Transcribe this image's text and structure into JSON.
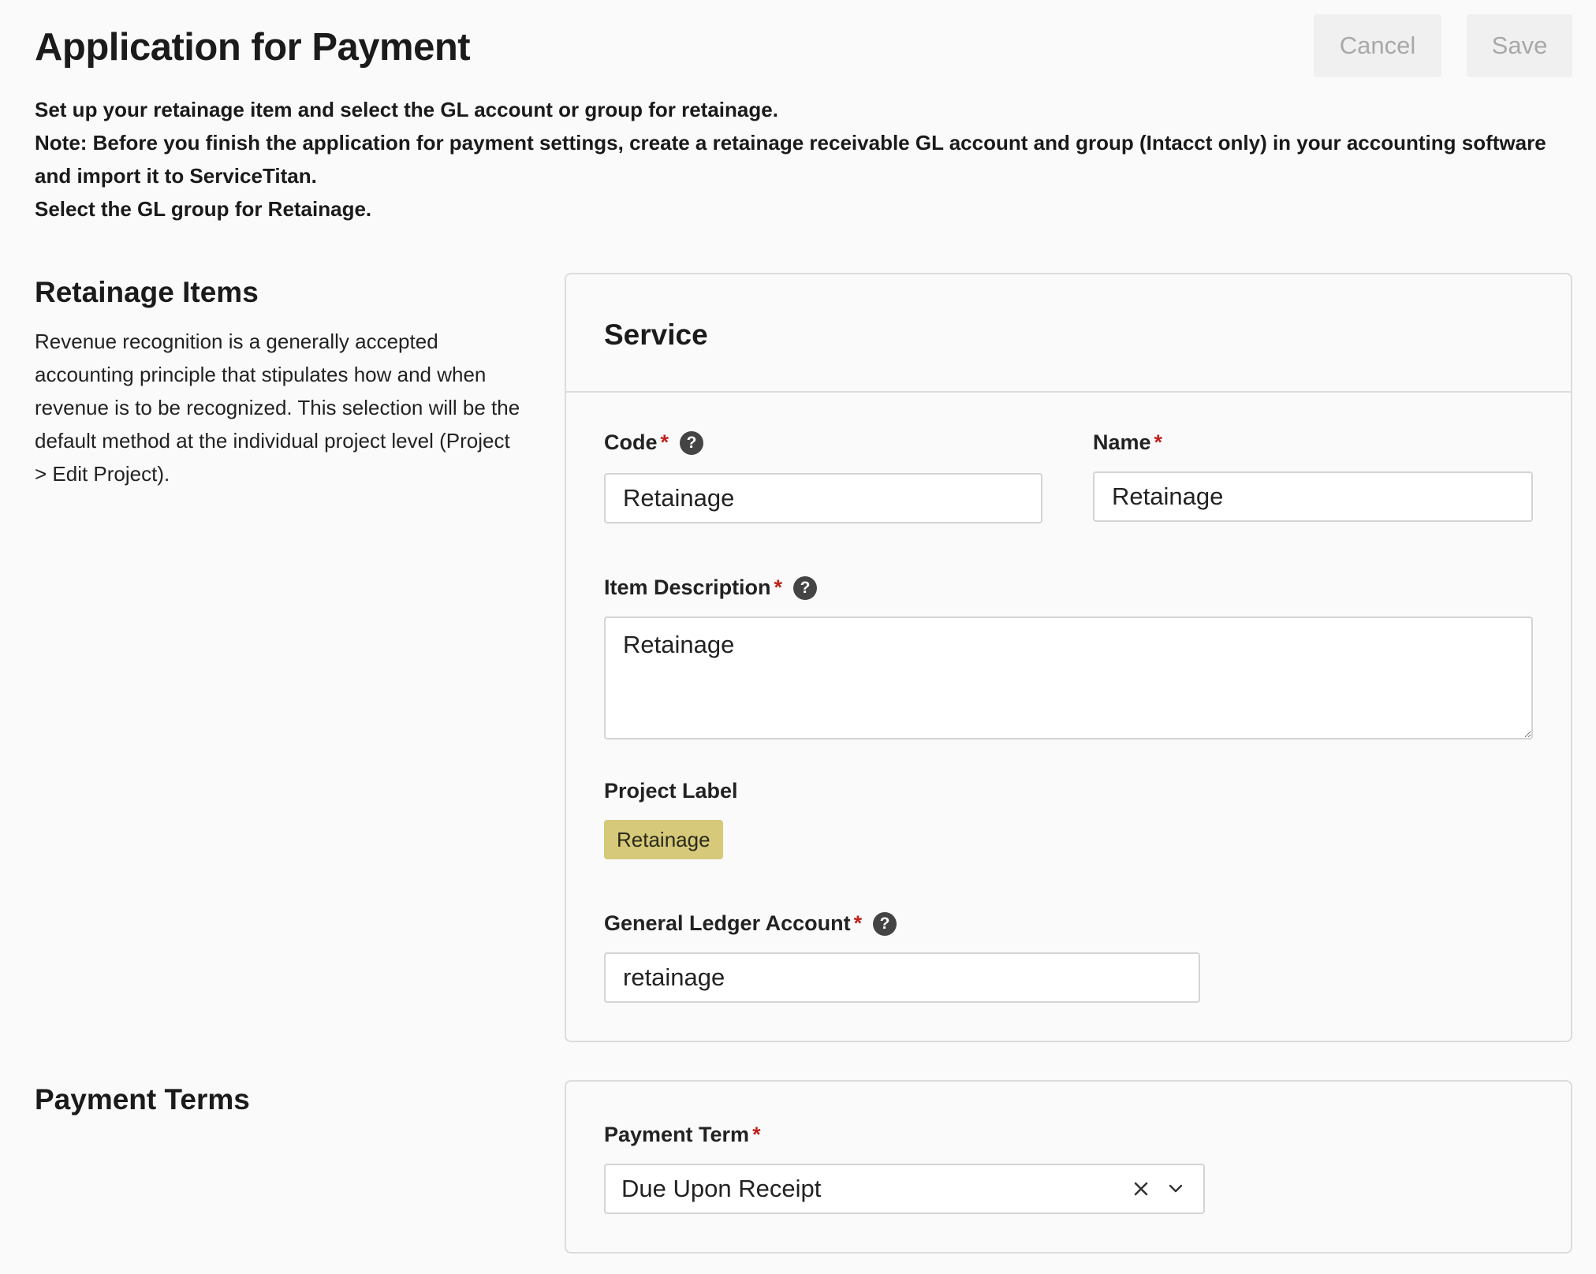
{
  "header": {
    "title": "Application for Payment",
    "cancel_label": "Cancel",
    "save_label": "Save"
  },
  "intro": {
    "line1": "Set up your retainage item and select the GL account or group for retainage.",
    "line2": "Note: Before you finish the application for payment settings, create a retainage receivable GL account and group (Intacct only) in your accounting software and import it to ServiceTitan.",
    "line3": "Select the GL group for Retainage."
  },
  "retainage_section": {
    "heading": "Retainage Items",
    "description": "Revenue recognition is a generally accepted accounting principle that stipulates how and when revenue is to be recognized. This selection will be the default method at the individual project level (Project > Edit Project)."
  },
  "service_card": {
    "title": "Service",
    "code": {
      "label": "Code",
      "required": "*",
      "value": "Retainage"
    },
    "name": {
      "label": "Name",
      "required": "*",
      "value": "Retainage"
    },
    "item_description": {
      "label": "Item Description",
      "required": "*",
      "value": "Retainage"
    },
    "project_label": {
      "label": "Project Label",
      "tag": "Retainage"
    },
    "gl_account": {
      "label": "General Ledger Account",
      "required": "*",
      "value": "retainage"
    }
  },
  "payment_terms_section": {
    "heading": "Payment Terms",
    "payment_term": {
      "label": "Payment Term",
      "required": "*",
      "value": "Due Upon Receipt"
    }
  },
  "icons": {
    "help": "question-circle-icon",
    "clear": "close-icon",
    "chevron": "chevron-down-icon"
  },
  "colors": {
    "required": "#c0201a",
    "tag_background": "#d6c97a",
    "help_icon": "#444444"
  }
}
